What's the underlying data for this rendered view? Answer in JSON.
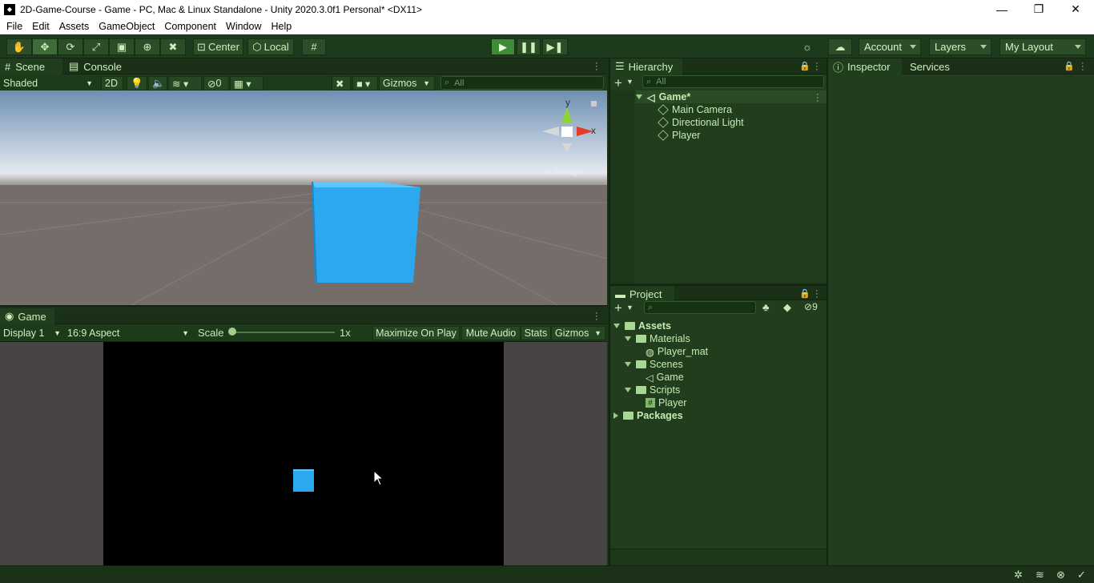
{
  "window": {
    "title": "2D-Game-Course - Game - PC, Mac & Linux Standalone - Unity 2020.3.0f1 Personal* <DX11>"
  },
  "menu": [
    "File",
    "Edit",
    "Assets",
    "GameObject",
    "Component",
    "Window",
    "Help"
  ],
  "toolbar": {
    "pivot": "Center",
    "space": "Local",
    "account": "Account",
    "layers": "Layers",
    "layout": "My Layout"
  },
  "scene": {
    "tab_scene": "Scene",
    "tab_console": "Console",
    "draw_mode": "Shaded",
    "mode_2d": "2D",
    "hidden_count": "0",
    "gizmos": "Gizmos",
    "search_placeholder": "All",
    "persp_label": "< Persp",
    "axis_y": "y",
    "axis_x": "x"
  },
  "game": {
    "tab": "Game",
    "display": "Display 1",
    "aspect": "16:9 Aspect",
    "scale_label": "Scale",
    "scale_value": "1x",
    "maximize": "Maximize On Play",
    "mute": "Mute Audio",
    "stats": "Stats",
    "gizmos": "Gizmos"
  },
  "hierarchy": {
    "tab": "Hierarchy",
    "search_placeholder": "All",
    "scene_name": "Game*",
    "items": [
      "Main Camera",
      "Directional Light",
      "Player"
    ]
  },
  "project": {
    "tab": "Project",
    "hidden_count": "9",
    "root": "Assets",
    "materials": "Materials",
    "material_item": "Player_mat",
    "scenes": "Scenes",
    "scene_item": "Game",
    "scripts": "Scripts",
    "script_item": "Player",
    "packages": "Packages"
  },
  "inspector": {
    "tab_inspector": "Inspector",
    "tab_services": "Services"
  },
  "colors": {
    "cube": "#2ba8f0",
    "theme": "#213d1e",
    "play": "#3f8c36"
  }
}
